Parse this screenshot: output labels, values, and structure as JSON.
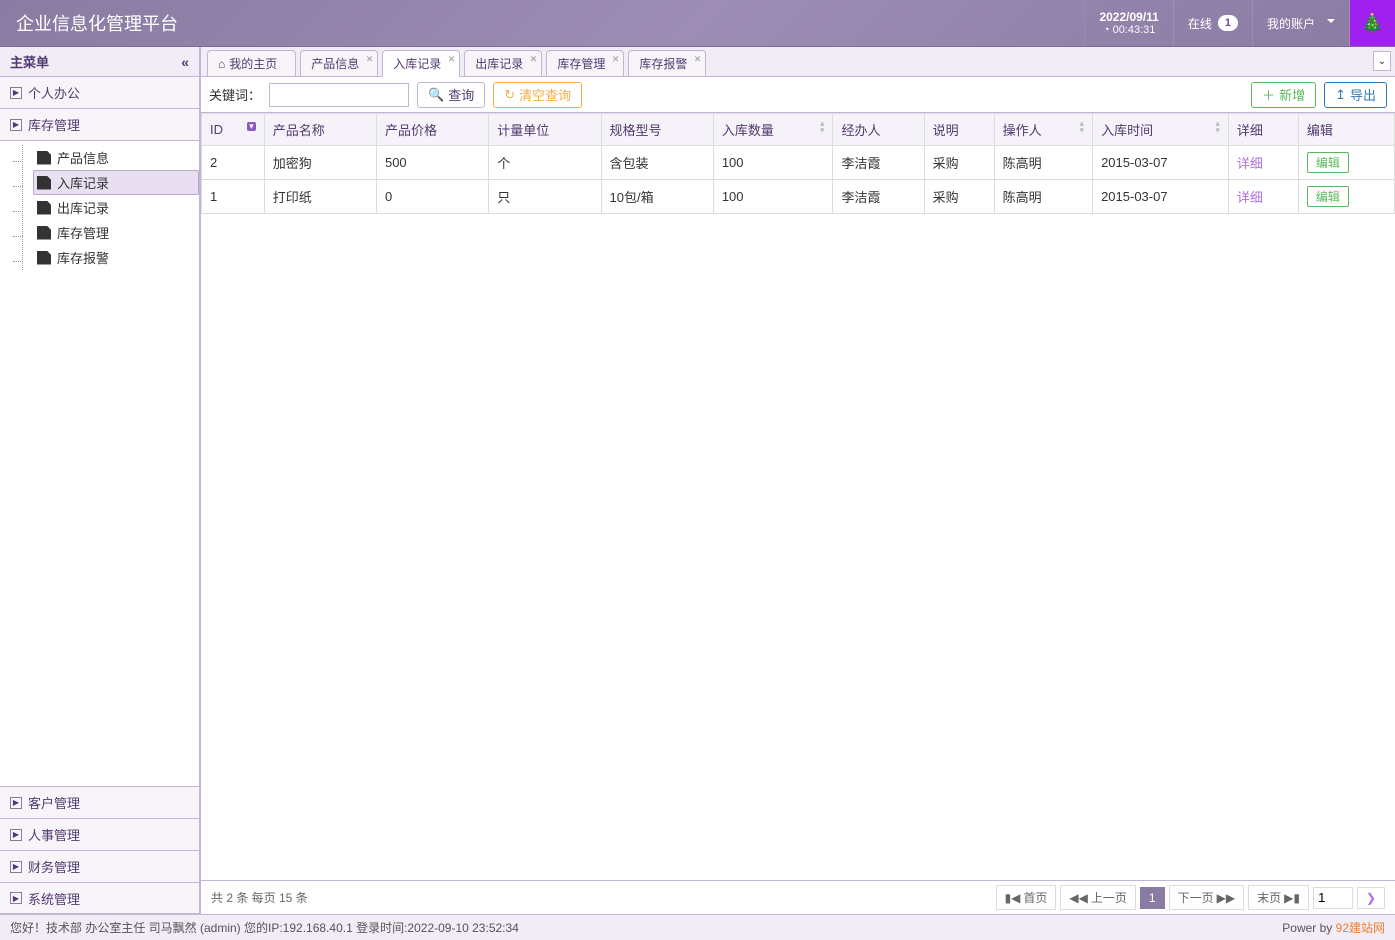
{
  "header": {
    "title": "企业信息化管理平台",
    "date": "2022/09/11",
    "time": "00:43:31",
    "online_label": "在线",
    "online_count": "1",
    "account_label": "我的账户"
  },
  "sidebar": {
    "menu_title": "主菜单",
    "groups_top": [
      {
        "label": "个人办公"
      }
    ],
    "open_group": {
      "label": "库存管理",
      "items": [
        {
          "label": "产品信息"
        },
        {
          "label": "入库记录",
          "active": true
        },
        {
          "label": "出库记录"
        },
        {
          "label": "库存管理"
        },
        {
          "label": "库存报警"
        }
      ]
    },
    "groups_bottom": [
      {
        "label": "客户管理"
      },
      {
        "label": "人事管理"
      },
      {
        "label": "财务管理"
      },
      {
        "label": "系统管理"
      }
    ]
  },
  "tabs": [
    {
      "label": "我的主页",
      "home": true
    },
    {
      "label": "产品信息"
    },
    {
      "label": "入库记录",
      "active": true
    },
    {
      "label": "出库记录"
    },
    {
      "label": "库存管理"
    },
    {
      "label": "库存报警"
    }
  ],
  "toolbar": {
    "keyword_label": "关键词：",
    "keyword_value": "",
    "search_label": "查询",
    "clear_label": "清空查询",
    "add_label": "新增",
    "export_label": "导出"
  },
  "table": {
    "columns": [
      {
        "key": "id",
        "label": "ID",
        "sortable": true,
        "sort": "desc"
      },
      {
        "key": "name",
        "label": "产品名称"
      },
      {
        "key": "price",
        "label": "产品价格"
      },
      {
        "key": "unit",
        "label": "计量单位"
      },
      {
        "key": "spec",
        "label": "规格型号"
      },
      {
        "key": "qty",
        "label": "入库数量",
        "sortable": true
      },
      {
        "key": "handler",
        "label": "经办人"
      },
      {
        "key": "note",
        "label": "说明"
      },
      {
        "key": "operator",
        "label": "操作人",
        "sortable": true
      },
      {
        "key": "time",
        "label": "入库时间",
        "sortable": true
      },
      {
        "key": "detail",
        "label": "详细"
      },
      {
        "key": "edit",
        "label": "编辑"
      }
    ],
    "detail_link": "详细",
    "edit_button": "编辑",
    "rows": [
      {
        "id": "2",
        "name": "加密狗",
        "price": "500",
        "unit": "个",
        "spec": "含包装",
        "qty": "100",
        "handler": "李洁霞",
        "note": "采购",
        "operator": "陈高明",
        "time": "2015-03-07"
      },
      {
        "id": "1",
        "name": "打印纸",
        "price": "0",
        "unit": "只",
        "spec": "10包/箱",
        "qty": "100",
        "handler": "李洁霞",
        "note": "采购",
        "operator": "陈高明",
        "time": "2015-03-07"
      }
    ]
  },
  "pager": {
    "summary": "共 2 条 每页 15 条",
    "first": "首页",
    "prev": "上一页",
    "current": "1",
    "next": "下一页",
    "last": "末页",
    "goto": "1"
  },
  "footer": {
    "greeting": "您好！技术部 办公室主任 司马飘然 (admin) 您的IP:192.168.40.1 登录时间:2022-09-10 23:52:34",
    "power_by": "Power by ",
    "power_link": "92建站网"
  }
}
